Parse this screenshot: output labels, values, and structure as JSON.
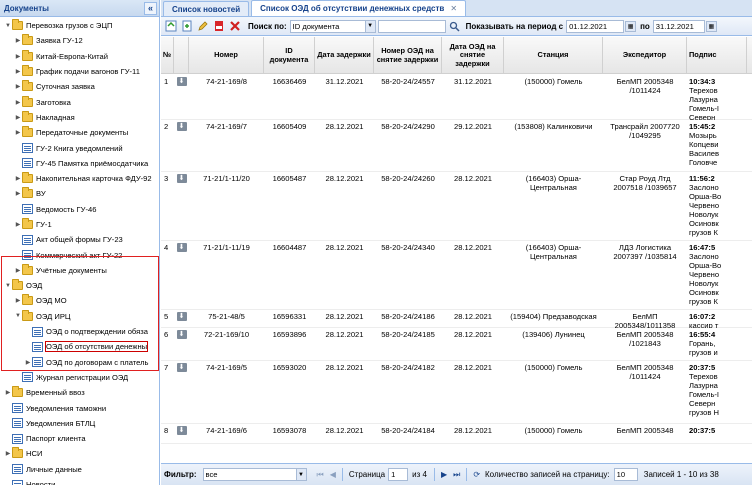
{
  "left": {
    "title": "Документы",
    "tree": [
      {
        "label": "Перевозка грузов с ЭЦП",
        "icon": "folder",
        "level": 0,
        "exp": "▼"
      },
      {
        "label": "Заявка ГУ-12",
        "icon": "folder",
        "level": 1,
        "exp": "▶"
      },
      {
        "label": "Китай-Европа-Китай",
        "icon": "folder",
        "level": 1,
        "exp": "▶"
      },
      {
        "label": "График подачи вагонов ГУ-11",
        "icon": "folder",
        "level": 1,
        "exp": "▶"
      },
      {
        "label": "Суточная заявка",
        "icon": "folder",
        "level": 1,
        "exp": "▶"
      },
      {
        "label": "Заготовка",
        "icon": "folder",
        "level": 1,
        "exp": "▶"
      },
      {
        "label": "Накладная",
        "icon": "folder",
        "level": 1,
        "exp": "▶"
      },
      {
        "label": "Передаточные документы",
        "icon": "folder",
        "level": 1,
        "exp": "▶"
      },
      {
        "label": "ГУ-2 Книга уведомлений",
        "icon": "doc",
        "level": 1,
        "exp": ""
      },
      {
        "label": "ГУ-45 Памятка приёмосдатчика",
        "icon": "doc",
        "level": 1,
        "exp": ""
      },
      {
        "label": "Накопительная карточка ФДУ-92",
        "icon": "folder",
        "level": 1,
        "exp": "▶"
      },
      {
        "label": "ВУ",
        "icon": "folder",
        "level": 1,
        "exp": "▶"
      },
      {
        "label": "Ведомость ГУ-46",
        "icon": "doc",
        "level": 1,
        "exp": ""
      },
      {
        "label": "ГУ-1",
        "icon": "folder",
        "level": 1,
        "exp": "▶"
      },
      {
        "label": "Акт общей формы ГУ-23",
        "icon": "doc",
        "level": 1,
        "exp": ""
      },
      {
        "label": "Коммерческий акт ГУ-22",
        "icon": "doc",
        "level": 1,
        "exp": ""
      },
      {
        "label": "Учётные документы",
        "icon": "folder",
        "level": 1,
        "exp": "▶"
      },
      {
        "label": "ОЭД",
        "icon": "folder",
        "level": 0,
        "exp": "▼"
      },
      {
        "label": "ОЭД МО",
        "icon": "folder",
        "level": 1,
        "exp": "▶"
      },
      {
        "label": "ОЭД ИРЦ",
        "icon": "folder",
        "level": 1,
        "exp": "▼"
      },
      {
        "label": "ОЭД о подтверждении обяза",
        "icon": "doc",
        "level": 2,
        "exp": ""
      },
      {
        "label": "ОЭД об отсутствии денежны",
        "icon": "doc",
        "level": 2,
        "exp": "",
        "selected": true
      },
      {
        "label": "ОЭД по договорам с платель",
        "icon": "doc",
        "level": 2,
        "exp": "▶"
      },
      {
        "label": "Журнал регистрации ОЭД",
        "icon": "doc",
        "level": 1,
        "exp": ""
      },
      {
        "label": "Временный ввоз",
        "icon": "folder",
        "level": 0,
        "exp": "▶"
      },
      {
        "label": "Уведомления таможни",
        "icon": "doc",
        "level": 0,
        "exp": ""
      },
      {
        "label": "Уведомления БТЛЦ",
        "icon": "doc",
        "level": 0,
        "exp": ""
      },
      {
        "label": "Паспорт клиента",
        "icon": "doc",
        "level": 0,
        "exp": ""
      },
      {
        "label": "НСИ",
        "icon": "folder",
        "level": 0,
        "exp": "▶"
      },
      {
        "label": "Личные данные",
        "icon": "doc",
        "level": 0,
        "exp": ""
      },
      {
        "label": "Новости",
        "icon": "doc",
        "level": 0,
        "exp": ""
      },
      {
        "label": "Помощь",
        "icon": "info",
        "level": 0,
        "exp": "▶"
      }
    ]
  },
  "tabs": [
    {
      "label": "Список новостей",
      "active": false
    },
    {
      "label": "Список ОЭД об отсутствии денежных средств",
      "active": true
    }
  ],
  "toolbar": {
    "search_label": "Поиск по:",
    "search_field": "ID документа",
    "search_value": "",
    "period_label": "Показывать на период с",
    "date_from": "01.12.2021",
    "to_label": "по",
    "date_to": "31.12.2021"
  },
  "grid": {
    "columns": [
      "№",
      "",
      "Номер",
      "ID документа",
      "Дата задержки",
      "Номер ОЭД на снятие задержки",
      "Дата ОЭД на снятие задержки",
      "Станция",
      "Экспедитор",
      "Подпис"
    ],
    "rows": [
      {
        "n": "1",
        "num": "74-21-169/8",
        "id": "16636469",
        "date": "31.12.2021",
        "oed": "58-20-24/24557",
        "oed_date": "31.12.2021",
        "station": "(150000) Гомель",
        "exp": "БелМП 2005348 /1011424",
        "sign_time": "10:34:3",
        "sign_lines": [
          "Терехов",
          "Лазурна",
          "Гомель-І",
          "Северн",
          "грузов Н"
        ]
      },
      {
        "n": "2",
        "num": "74-21-169/7",
        "id": "16605409",
        "date": "28.12.2021",
        "oed": "58-20-24/24290",
        "oed_date": "29.12.2021",
        "station": "(153808) Калинковичи",
        "exp": "Трансрайл 2007720 /1049295",
        "sign_time": "15:45:2",
        "sign_lines": [
          "Мозырь",
          "Копцеви",
          "Василев",
          "Головче"
        ]
      },
      {
        "n": "3",
        "num": "71-21/1-11/20",
        "id": "16605487",
        "date": "28.12.2021",
        "oed": "58-20-24/24260",
        "oed_date": "28.12.2021",
        "station": "(166403) Орша-Центральная",
        "exp": "Стар Роуд Лтд 2007518 /1039657",
        "sign_time": "11:56:2",
        "sign_lines": [
          "Заслоно",
          "Орша-Во",
          "Червено",
          "Новолук",
          "Осиновк",
          "грузов К"
        ]
      },
      {
        "n": "4",
        "num": "71-21/1-11/19",
        "id": "16604487",
        "date": "28.12.2021",
        "oed": "58-20-24/24340",
        "oed_date": "28.12.2021",
        "station": "(166403) Орша-Центральная",
        "exp": "ЛДЗ Логистика 2007397 /1035814",
        "sign_time": "16:47:5",
        "sign_lines": [
          "Заслоно",
          "Орша-Во",
          "Червено",
          "Новолук",
          "Осиновк",
          "грузов К"
        ]
      },
      {
        "n": "5",
        "num": "75-21-48/5",
        "id": "16596331",
        "date": "28.12.2021",
        "oed": "58-20-24/24186",
        "oed_date": "28.12.2021",
        "station": "(159404) Предзаводская",
        "exp": "БелМП 2005348/1011358",
        "sign_time": "16:07:2",
        "sign_lines": [
          "кассир т"
        ]
      },
      {
        "n": "6",
        "num": "72-21-169/10",
        "id": "16593896",
        "date": "28.12.2021",
        "oed": "58-20-24/24185",
        "oed_date": "28.12.2021",
        "station": "(139406) Лунинец",
        "exp": "БелМП 2005348 /1021843",
        "sign_time": "16:55:4",
        "sign_lines": [
          "Горань,",
          "грузов и"
        ]
      },
      {
        "n": "7",
        "num": "74-21-169/5",
        "id": "16593020",
        "date": "28.12.2021",
        "oed": "58-20-24/24182",
        "oed_date": "28.12.2021",
        "station": "(150000) Гомель",
        "exp": "БелМП 2005348 /1011424",
        "sign_time": "20:37:5",
        "sign_lines": [
          "Терехов",
          "Лазурна",
          "Гомель-І",
          "Северн",
          "грузов Н"
        ]
      },
      {
        "n": "8",
        "num": "74-21-169/6",
        "id": "16593078",
        "date": "28.12.2021",
        "oed": "58-20-24/24184",
        "oed_date": "28.12.2021",
        "station": "(150000) Гомель",
        "exp": "БелМП 2005348",
        "sign_time": "20:37:5",
        "sign_lines": []
      }
    ]
  },
  "bottom": {
    "filter_label": "Фильтр:",
    "filter_value": "все",
    "page_label": "Страница",
    "page_value": "1",
    "of_label": "из 4",
    "per_page_label": "Количество записей на страницу:",
    "per_page_value": "10",
    "records_info": "Записей 1 - 10 из 38"
  }
}
